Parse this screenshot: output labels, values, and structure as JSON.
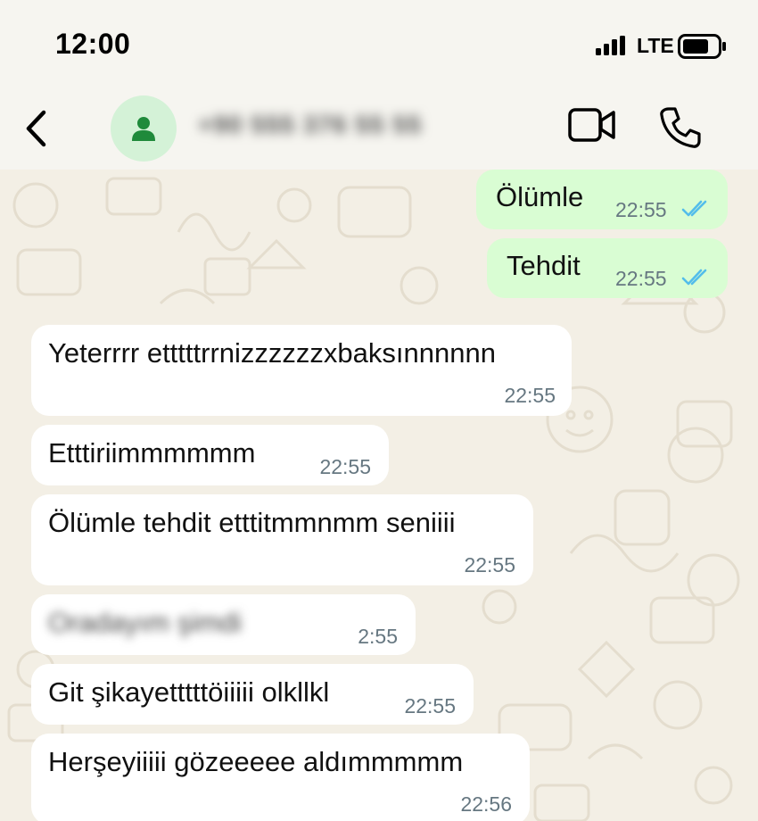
{
  "status_bar": {
    "time": "12:00",
    "network": "LTE",
    "icons": [
      "signal-icon",
      "battery-icon"
    ]
  },
  "header": {
    "contact_name": "+90 555 376 55 55",
    "icons": [
      "back-chevron-icon",
      "person-icon",
      "video-camera-icon",
      "phone-icon"
    ]
  },
  "colors": {
    "outgoing_bubble": "#d9fdd3",
    "incoming_bubble": "#ffffff",
    "read_ticks": "#53bdeb",
    "avatar_bg": "#d4f2d7",
    "avatar_icon": "#1f8a3b"
  },
  "messages": [
    {
      "direction": "outgoing",
      "text": "Ölümle",
      "time": "22:55",
      "status": "read"
    },
    {
      "direction": "outgoing",
      "text": "Tehdit",
      "time": "22:55",
      "status": "read"
    },
    {
      "direction": "incoming",
      "text": "Yeterrrr etttttrrnizzzzzzxbaksınnnnnn",
      "time": "22:55"
    },
    {
      "direction": "incoming",
      "text": "Etttiriimmmmmm",
      "time": "22:55"
    },
    {
      "direction": "incoming",
      "text": "Ölümle tehdit etttitmmnmm seniiii",
      "time": "22:55"
    },
    {
      "direction": "incoming",
      "text": "Oradayım şimdi",
      "time": "2:55",
      "redacted": true
    },
    {
      "direction": "incoming",
      "text": "Git şikayetttttöiiiii olkllkl",
      "time": "22:55"
    },
    {
      "direction": "incoming",
      "text": "Herşeyiiiii gözeeeee aldımmmmm",
      "time": "22:56"
    }
  ]
}
